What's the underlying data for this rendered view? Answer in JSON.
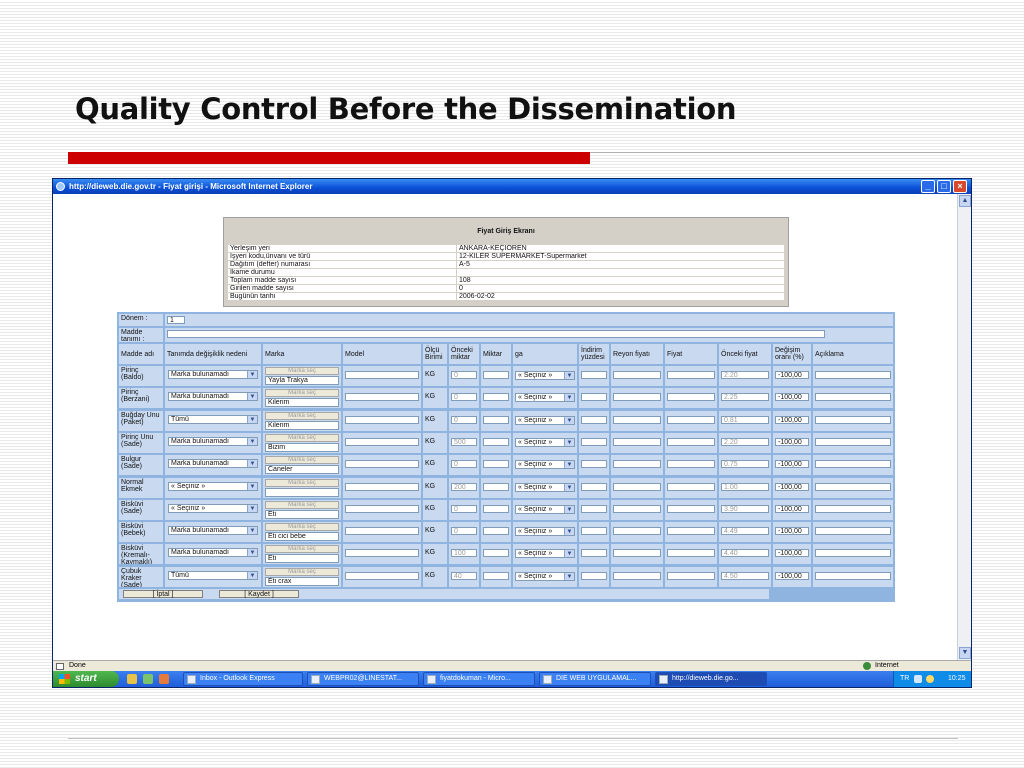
{
  "slide": {
    "title": "Quality Control Before the Dissemination"
  },
  "window": {
    "title": "http://dieweb.die.gov.tr - Fiyat girişi - Microsoft Internet Explorer",
    "status_text": "Done",
    "zone_text": "Internet"
  },
  "taskbar": {
    "start_label": "start",
    "tasks": [
      "Inbox - Outlook Express",
      "WEBPR02@LINESTAT...",
      "fiyatdokuman - Micro...",
      "DIE WEB UYGULAMAL...",
      "http://dieweb.die.go..."
    ],
    "tray_lang": "TR",
    "clock": "10:25"
  },
  "fiyat_panel": {
    "header": "Fiyat Giriş Ekranı",
    "rows": [
      {
        "label": "Yerleşim yeri",
        "value": "ANKARA-KEÇİÖREN"
      },
      {
        "label": "İşyeri kodu,ünvanı ve türü",
        "value": "12-KİLER SÜPERMARKET-Supermarket"
      },
      {
        "label": "Dağıtım (defter) numarası",
        "value": "A-5"
      },
      {
        "label": "İkame durumu",
        "value": ""
      },
      {
        "label": "Toplam madde sayısı",
        "value": "108"
      },
      {
        "label": "Girilen madde sayısı",
        "value": "0"
      },
      {
        "label": "Bugünün tarihi",
        "value": "2006-02-02"
      }
    ]
  },
  "form": {
    "donem_label": "Dönem :",
    "donem_value": "1",
    "madde_tanimi_label": "Madde tanımı :",
    "columns": {
      "madde_adi": "Madde adı",
      "tanimda": "Tanımda değişiklik nedeni",
      "marka": "Marka",
      "model": "Model",
      "olcu": "Ölçü Birimi",
      "onceki_miktar": "Önceki miktar",
      "miktar": "Miktar",
      "ga": "ga",
      "indirim": "İndirim yüzdesi",
      "reyon": "Reyon fiyatı",
      "fiyat": "Fiyat",
      "onceki_fiyat": "Önceki fiyat",
      "degisim": "Değişim oranı (%)",
      "aciklama": "Açıklama"
    },
    "marka_sec_label": "Marka seç",
    "rows": [
      {
        "madde": "Pirinç (Baldo)",
        "neden": "Marka bulunamadı",
        "marka": "Yayla Trakya",
        "olcu": "KG",
        "onceki_miktar": "0",
        "ga": "« Seçiniz »",
        "onceki_fiyat": "2.20",
        "degisim": "-100,00"
      },
      {
        "madde": "Pirinç (Berzani)",
        "neden": "Marka bulunamadı",
        "marka": "Kilerim",
        "olcu": "KG",
        "onceki_miktar": "0",
        "ga": "« Seçiniz »",
        "onceki_fiyat": "2.25",
        "degisim": "-100,00"
      },
      {
        "madde": "Buğday Unu (Paket)",
        "neden": "Tümü",
        "marka": "Kilerim",
        "olcu": "KG",
        "onceki_miktar": "0",
        "ga": "« Seçiniz »",
        "onceki_fiyat": "0.81",
        "degisim": "-100,00"
      },
      {
        "madde": "Pirinç Unu (Sade)",
        "neden": "Marka bulunamadı",
        "marka": "Bizim",
        "olcu": "KG",
        "onceki_miktar": "500",
        "ga": "« Seçiniz »",
        "onceki_fiyat": "2.20",
        "degisim": "-100,00"
      },
      {
        "madde": "Bulgur (Sade)",
        "neden": "Marka bulunamadı",
        "marka": "Caneler",
        "olcu": "KG",
        "onceki_miktar": "0",
        "ga": "« Seçiniz »",
        "onceki_fiyat": "0.75",
        "degisim": "-100,00"
      },
      {
        "madde": "Normal Ekmek",
        "neden": "« Seçiniz »",
        "marka": "",
        "olcu": "KG",
        "onceki_miktar": "200",
        "ga": "« Seçiniz »",
        "onceki_fiyat": "1.00",
        "degisim": "-100,00"
      },
      {
        "madde": "Bisküvi (Sade)",
        "neden": "« Seçiniz »",
        "marka": "Eti",
        "olcu": "KG",
        "onceki_miktar": "0",
        "ga": "« Seçiniz »",
        "onceki_fiyat": "3.90",
        "degisim": "-100,00"
      },
      {
        "madde": "Bisküvi (Bebek)",
        "neden": "Marka bulunamadı",
        "marka": "Eti cici bebe",
        "olcu": "KG",
        "onceki_miktar": "0",
        "ga": "« Seçiniz »",
        "onceki_fiyat": "4.49",
        "degisim": "-100,00"
      },
      {
        "madde": "Bisküvi (Kremalı-Kaymaklı)",
        "neden": "Marka bulunamadı",
        "marka": "Eti",
        "olcu": "KG",
        "onceki_miktar": "100",
        "ga": "« Seçiniz »",
        "onceki_fiyat": "4.40",
        "degisim": "-100,00"
      },
      {
        "madde": "Çubuk Kraker (Sade)",
        "neden": "Tümü",
        "marka": "Eti crax",
        "olcu": "KG",
        "onceki_miktar": "40",
        "ga": "« Seçiniz »",
        "onceki_fiyat": "4.50",
        "degisim": "-100,00"
      }
    ],
    "iptal_label": "[        İptal        ]",
    "kaydet_label": "[        Kaydet        ]"
  }
}
